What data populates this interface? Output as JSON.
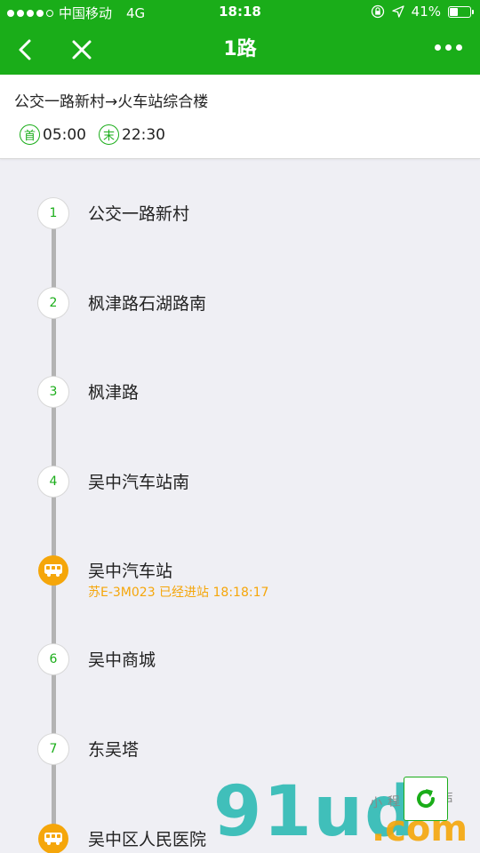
{
  "status_bar": {
    "carrier": "中国移动",
    "network": "4G",
    "time": "18:18",
    "battery": "41%",
    "battery_level": 0.41
  },
  "nav": {
    "title": "1路"
  },
  "route": {
    "direction": "公交一路新村→火车站综合楼",
    "first_label": "首",
    "first_time": "05:00",
    "last_label": "末",
    "last_time": "22:30"
  },
  "stops": [
    {
      "num": "1",
      "name": "公交一路新村"
    },
    {
      "num": "2",
      "name": "枫津路石湖路南"
    },
    {
      "num": "3",
      "name": "枫津路"
    },
    {
      "num": "4",
      "name": "吴中汽车站南"
    },
    {
      "num": "",
      "name": "吴中汽车站",
      "bus_info": "苏E-3M023 已经进站 18:18:17"
    },
    {
      "num": "6",
      "name": "吴中商城"
    },
    {
      "num": "7",
      "name": "东吴塔"
    },
    {
      "num": "",
      "name": "吴中区人民医院"
    }
  ],
  "watermark": {
    "main": "91ud",
    "suffix": ".com",
    "tagline": "小程序商店"
  },
  "colors": {
    "brand": "#1aad19",
    "bus": "#f5a60a"
  }
}
